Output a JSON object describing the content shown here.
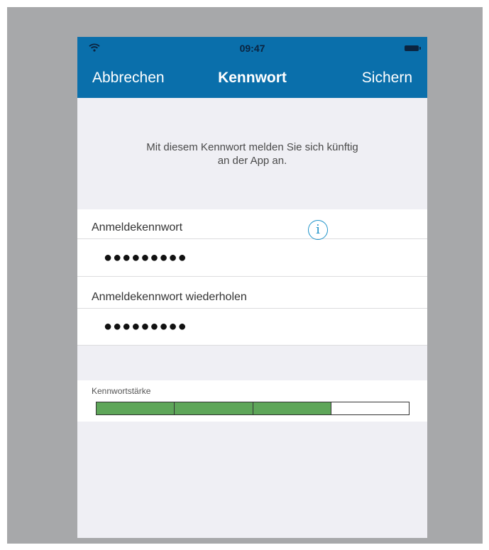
{
  "status_bar": {
    "time": "09:47",
    "wifi_icon": "wifi-icon",
    "battery_icon": "battery-icon"
  },
  "nav": {
    "cancel_label": "Abbrechen",
    "title": "Kennwort",
    "save_label": "Sichern"
  },
  "intro": {
    "line1": "Mit diesem Kennwort melden Sie sich künftig",
    "line2": "an der App an."
  },
  "form": {
    "password_label": "Anmeldekennwort",
    "password_value": "●●●●●●●●●",
    "info_icon": "info-icon",
    "repeat_label": "Anmeldekennwort wiederholen",
    "repeat_value": "●●●●●●●●●"
  },
  "strength": {
    "label": "Kennwortstärke",
    "filled_segments": 3,
    "total_segments": 4,
    "fill_color": "#5ea659"
  },
  "colors": {
    "nav_background": "#0a6fab",
    "info_icon": "#1e93c9"
  }
}
